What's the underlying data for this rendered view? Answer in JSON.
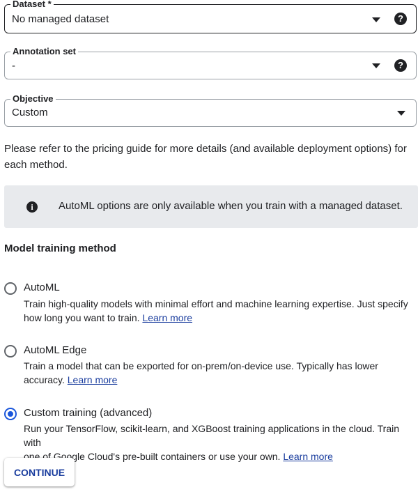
{
  "dataset": {
    "label": "Dataset *",
    "value": "No managed dataset",
    "help_icon": "question-icon"
  },
  "annotation_set": {
    "label": "Annotation set",
    "value": "-",
    "help_icon": "question-icon"
  },
  "objective": {
    "label": "Objective",
    "value": "Custom"
  },
  "pricing_note": {
    "line1": "Please refer to the pricing guide for more details (and available deployment options) for",
    "line2": "each method."
  },
  "info_banner": {
    "icon": "info-icon",
    "text": "AutoML options are only available when you train with a managed dataset."
  },
  "training": {
    "heading": "Model training method",
    "options": [
      {
        "title": "AutoML",
        "desc_line1": "Train high-quality models with minimal effort and machine learning expertise. Just specify",
        "desc_line2": "how long you want to train.",
        "link": "Learn more",
        "selected": false
      },
      {
        "title": "AutoML Edge",
        "desc_line1": "Train a model that can be exported for on-prem/on-device use. Typically has lower",
        "desc_line2": "accuracy.",
        "link": "Learn more",
        "selected": false
      },
      {
        "title": "Custom training (advanced)",
        "desc_line1": "Run your TensorFlow, scikit-learn, and XGBoost training applications in the cloud. Train with",
        "desc_line2": "one of Google Cloud's pre-built containers or use your own.",
        "link": "Learn more",
        "selected": true
      }
    ]
  },
  "continue_label": "CONTINUE",
  "colors": {
    "accent": "#1a56db",
    "link": "#1a3d9e",
    "banner_bg": "#e8eaed"
  }
}
